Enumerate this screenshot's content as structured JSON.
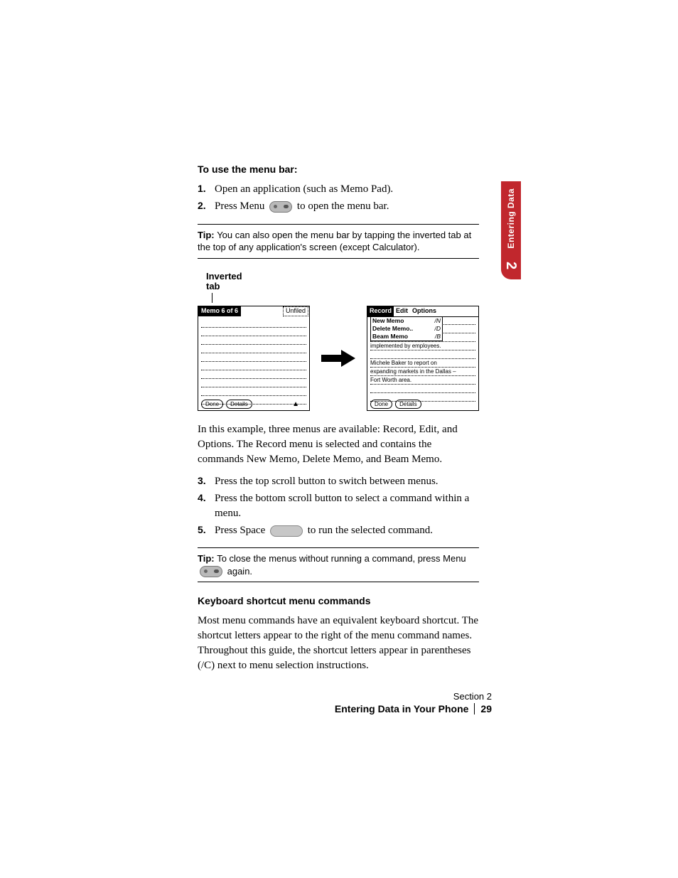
{
  "sidebar": {
    "label": "Entering Data",
    "chapter": "2"
  },
  "heading1": "To use the menu bar:",
  "steps1": [
    {
      "n": "1.",
      "text": "Open an application (such as Memo Pad)."
    },
    {
      "n": "2.",
      "pre": "Press Menu ",
      "post": " to open the menu bar."
    }
  ],
  "tip1": {
    "label": "Tip: ",
    "text": "You can also open the menu bar by tapping the inverted tab at the top of any application's screen (except Calculator)."
  },
  "figure": {
    "callout": {
      "l1": "Inverted",
      "l2": "tab"
    },
    "left": {
      "title": "Memo 6 of 6",
      "right_label": "Unfiled",
      "btn_done": "Done",
      "btn_details": "Details"
    },
    "right": {
      "menus": {
        "m1": "Record",
        "m2": "Edit",
        "m3": "Options"
      },
      "items": [
        {
          "label": "New Memo",
          "sc": "/N"
        },
        {
          "label": "Delete Memo..",
          "sc": "/D"
        },
        {
          "label": "Beam Memo",
          "sc": "/B"
        }
      ],
      "body_lines": [
        "",
        "",
        "",
        "implemented by employees.",
        "",
        "Michele Baker to report on",
        "expanding markets in the Dallas –",
        "Fort Worth area.",
        "",
        ""
      ],
      "btn_done": "Done",
      "btn_details": "Details"
    }
  },
  "para1": "In this example, three menus are available: Record, Edit, and Options. The Record menu is selected and contains the commands New Memo, Delete Memo, and Beam Memo.",
  "steps2": [
    {
      "n": "3.",
      "text": "Press the top scroll button to switch between menus."
    },
    {
      "n": "4.",
      "text": "Press the bottom scroll button to select a command within a menu."
    },
    {
      "n": "5.",
      "pre": "Press Space ",
      "post": " to run the selected command."
    }
  ],
  "tip2": {
    "label": "Tip: ",
    "pre": "To close the menus without running a command, press Menu ",
    "post": " again."
  },
  "heading2": "Keyboard shortcut menu commands",
  "para2": "Most menu commands have an equivalent keyboard shortcut. The shortcut letters appear to the right of the menu command names. Throughout this guide, the shortcut letters appear in parentheses (/C) next to menu selection instructions.",
  "footer": {
    "section": "Section 2",
    "title": "Entering Data in Your Phone",
    "page": "29"
  }
}
